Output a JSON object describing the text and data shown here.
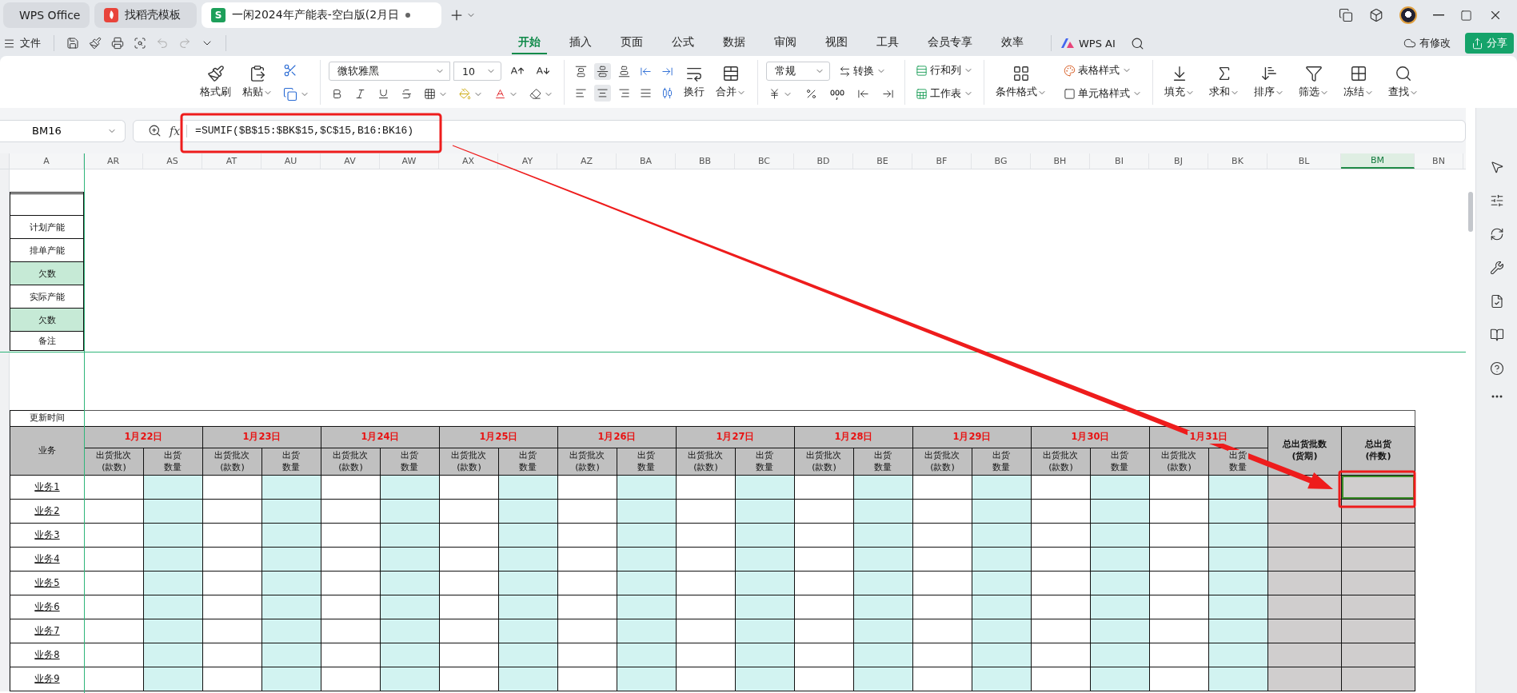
{
  "window_tabs": [
    {
      "kind": "home",
      "label": "WPS Office",
      "selected": false
    },
    {
      "kind": "template",
      "label": "找稻壳模板",
      "selected": false
    },
    {
      "kind": "sheet",
      "badge": "S",
      "label": "一闲2024年产能表-空白版(2月日",
      "selected": true,
      "modified": true
    }
  ],
  "menu": {
    "file": "文件",
    "tabs": [
      {
        "label": "开始",
        "selected": true
      },
      {
        "label": "插入",
        "selected": false
      },
      {
        "label": "页面",
        "selected": false
      },
      {
        "label": "公式",
        "selected": false
      },
      {
        "label": "数据",
        "selected": false
      },
      {
        "label": "审阅",
        "selected": false
      },
      {
        "label": "视图",
        "selected": false
      },
      {
        "label": "工具",
        "selected": false
      },
      {
        "label": "会员专享",
        "selected": false
      },
      {
        "label": "效率",
        "selected": false
      }
    ],
    "ai": "WPS AI",
    "status": "有修改",
    "share": "分享"
  },
  "ribbon": {
    "format_painter": "格式刷",
    "paste": "粘贴",
    "font": "微软雅黑",
    "size": "10",
    "wrap": "换行",
    "merge": "合并",
    "number_format": "常规",
    "convert": "转换",
    "rows_cols": "行和列",
    "worksheet": "工作表",
    "conditional": "条件格式",
    "table_style": "表格样式",
    "cell_style": "单元格样式",
    "tools": [
      "填充",
      "求和",
      "排序",
      "筛选",
      "冻结",
      "查找"
    ]
  },
  "formula_bar": {
    "name_box": "BM16",
    "fx": "fx",
    "formula": "=SUMIF($B$15:$BK$15,$C$15,B16:BK16)"
  },
  "columns": [
    {
      "label": "A",
      "selected": false
    },
    {
      "label": "AR",
      "selected": false
    },
    {
      "label": "AS",
      "selected": false
    },
    {
      "label": "AT",
      "selected": false
    },
    {
      "label": "AU",
      "selected": false
    },
    {
      "label": "AV",
      "selected": false
    },
    {
      "label": "AW",
      "selected": false
    },
    {
      "label": "AX",
      "selected": false
    },
    {
      "label": "AY",
      "selected": false
    },
    {
      "label": "AZ",
      "selected": false
    },
    {
      "label": "BA",
      "selected": false
    },
    {
      "label": "BB",
      "selected": false
    },
    {
      "label": "BC",
      "selected": false
    },
    {
      "label": "BD",
      "selected": false
    },
    {
      "label": "BE",
      "selected": false
    },
    {
      "label": "BF",
      "selected": false
    },
    {
      "label": "BG",
      "selected": false
    },
    {
      "label": "BH",
      "selected": false
    },
    {
      "label": "BI",
      "selected": false
    },
    {
      "label": "BJ",
      "selected": false
    },
    {
      "label": "BK",
      "selected": false
    },
    {
      "label": "BL",
      "selected": false
    },
    {
      "label": "BM",
      "selected": true
    },
    {
      "label": "BN",
      "selected": false
    }
  ],
  "plan_labels": [
    {
      "label": "计划产能",
      "highlighted": false
    },
    {
      "label": "排单产能",
      "highlighted": false
    },
    {
      "label": "欠数",
      "highlighted": true
    },
    {
      "label": "实际产能",
      "highlighted": false
    },
    {
      "label": "欠数",
      "highlighted": true
    },
    {
      "label": "备注",
      "highlighted": false
    }
  ],
  "update_label": "更新时间",
  "table": {
    "row_header": "业务",
    "dates": [
      {
        "date": "1月22日",
        "batch": "出货批次(款数)",
        "qty": "出货数量"
      },
      {
        "date": "1月23日",
        "batch": "出货批次(款数)",
        "qty": "出货数量"
      },
      {
        "date": "1月24日",
        "batch": "出货批次(款数)",
        "qty": "出货数量"
      },
      {
        "date": "1月25日",
        "batch": "出货批次(款数)",
        "qty": "出货数量"
      },
      {
        "date": "1月26日",
        "batch": "出货批次(款数)",
        "qty": "出货数量"
      },
      {
        "date": "1月27日",
        "batch": "出货批次(款数)",
        "qty": "出货数量"
      },
      {
        "date": "1月28日",
        "batch": "出货批次(款数)",
        "qty": "出货数量"
      },
      {
        "date": "1月29日",
        "batch": "出货批次(款数)",
        "qty": "出货数量"
      },
      {
        "date": "1月30日",
        "batch": "出货批次(款数)",
        "qty": "出货数量"
      },
      {
        "date": "1月31日",
        "batch": "出货批次(款数)",
        "qty": "出货数量"
      }
    ],
    "totals": [
      "总出货批数(货期)",
      "总出货(件数)"
    ],
    "rows": [
      {
        "label": "业务1",
        "selected": true
      },
      {
        "label": "业务2",
        "selected": false
      },
      {
        "label": "业务3",
        "selected": false
      },
      {
        "label": "业务4",
        "selected": false
      },
      {
        "label": "业务5",
        "selected": false
      },
      {
        "label": "业务6",
        "selected": false
      },
      {
        "label": "业务7",
        "selected": false
      },
      {
        "label": "业务8",
        "selected": false
      },
      {
        "label": "业务9",
        "selected": false
      }
    ]
  }
}
